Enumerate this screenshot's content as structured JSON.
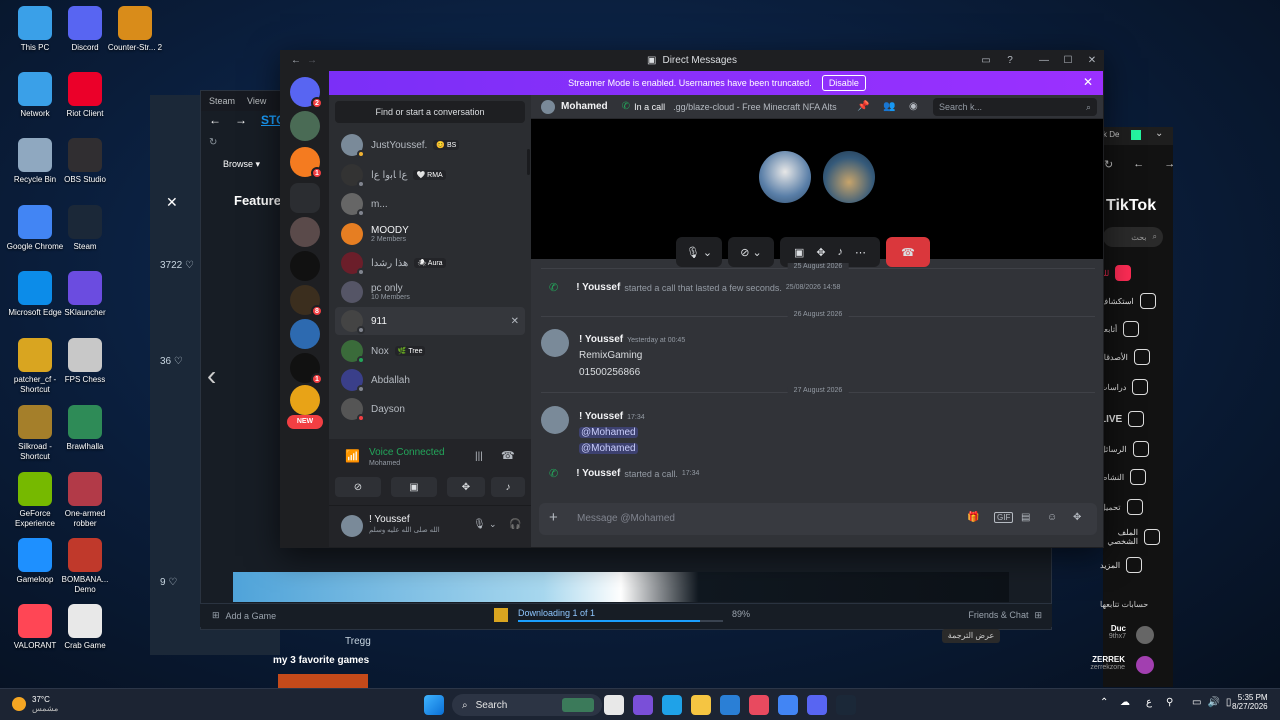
{
  "desktop": {
    "icons": [
      {
        "label": "This PC",
        "icon": "computer-icon",
        "color": "#3aa0e8"
      },
      {
        "label": "Discord",
        "icon": "discord-icon",
        "color": "#5865f2"
      },
      {
        "label": "Counter-Str... 2",
        "icon": "cs2-icon",
        "color": "#d98c1a"
      },
      {
        "label": "Network",
        "icon": "network-icon",
        "color": "#3aa0e8"
      },
      {
        "label": "Riot Client",
        "icon": "riot-icon",
        "color": "#eb0029"
      },
      {
        "label": "Recycle Bin",
        "icon": "recycle-bin-icon",
        "color": "#8fa8c0"
      },
      {
        "label": "OBS Studio",
        "icon": "obs-icon",
        "color": "#302e31"
      },
      {
        "label": "Google Chrome",
        "icon": "chrome-icon",
        "color": "#4285f4"
      },
      {
        "label": "Steam",
        "icon": "steam-icon",
        "color": "#1b2838"
      },
      {
        "label": "Microsoft Edge",
        "icon": "edge-icon",
        "color": "#0c8ce9"
      },
      {
        "label": "SKlauncher",
        "icon": "sklauncher-icon",
        "color": "#6b4ce0"
      },
      {
        "label": "patcher_cf - Shortcut",
        "icon": "patcher-icon",
        "color": "#d9a520"
      },
      {
        "label": "FPS Chess",
        "icon": "chess-icon",
        "color": "#c8c8c8"
      },
      {
        "label": "Silkroad - Shortcut",
        "icon": "silkroad-icon",
        "color": "#a57f2a"
      },
      {
        "label": "Brawlhalla",
        "icon": "brawlhalla-icon",
        "color": "#2e8b57"
      },
      {
        "label": "GeForce Experience",
        "icon": "geforce-icon",
        "color": "#76b900"
      },
      {
        "label": "One-armed robber",
        "icon": "oar-icon",
        "color": "#b23a48"
      },
      {
        "label": "Gameloop",
        "icon": "gameloop-icon",
        "color": "#1e90ff"
      },
      {
        "label": "BOMBANA... Demo",
        "icon": "bombana-icon",
        "color": "#c0392b"
      },
      {
        "label": "VALORANT",
        "icon": "valorant-icon",
        "color": "#ff4655"
      },
      {
        "label": "Crab Game",
        "icon": "crab-game-icon",
        "color": "#e8e8e8"
      }
    ]
  },
  "steam": {
    "menu": [
      "Steam",
      "View"
    ],
    "store_label": "STOR",
    "browse_label": "Browse",
    "featured_label": "Feature",
    "likes": [
      "3722 ♡",
      "36 ♡",
      "9 ♡"
    ],
    "add_game": "Add a Game",
    "downloading": "Downloading 1 of 1",
    "download_pct": 89,
    "download_pct_text": "89%",
    "friends_chat": "Friends & Chat",
    "tregg": "Tregg",
    "favorite_games": "my 3 favorite games"
  },
  "tiktok": {
    "logo": "TikTok",
    "search_placeholder": "بحث",
    "nav": [
      "لك",
      "استكشاف",
      "أتابعه",
      "الأصدقاء",
      "دراسات",
      "LIVE",
      "الرسائل",
      "النشاط",
      "تحميل",
      "الملف الشخصي",
      "المزيد"
    ],
    "following_title": "حسابات تتابعها",
    "accounts": [
      {
        "name": "Duc",
        "handle": "9thx7"
      },
      {
        "name": "ZERREK",
        "handle": "zerrekzone"
      }
    ],
    "translate_btn": "عرض الترجمة"
  },
  "discord": {
    "title": "Direct Messages",
    "streamer_text": "Streamer Mode is enabled. Usernames have been truncated.",
    "disable_label": "Disable",
    "find_placeholder": "Find or start a conversation",
    "servers": [
      {
        "badge": "2",
        "color": "#5865f2",
        "icon": "discord-home-icon"
      },
      {
        "badge": "",
        "color": "#4a6b55",
        "icon": "server-icon"
      },
      {
        "badge": "1",
        "color": "#f47b20",
        "icon": "friend-request-icon"
      },
      {
        "badge": "",
        "color": "#5865f2",
        "icon": "folder-icon"
      },
      {
        "badge": "",
        "color": "#5a4a4a",
        "icon": "server-icon"
      },
      {
        "badge": "",
        "color": "#111",
        "icon": "cup-icon"
      },
      {
        "badge": "8",
        "color": "#3b2e1e",
        "icon": "server-icon"
      },
      {
        "badge": "",
        "color": "#2d6ab0",
        "icon": "server-icon"
      },
      {
        "badge": "1",
        "color": "#111",
        "icon": "blackout-icon"
      },
      {
        "badge": "",
        "color": "#e8a317",
        "icon": "dr-icon"
      }
    ],
    "new_badge": "NEW",
    "dms": [
      {
        "name": "JustYoussef.",
        "sub": "",
        "tag": "😊 BS",
        "status": "#f0b232",
        "color": "#7a8a99"
      },
      {
        "name": "ﻉﺍ ﺎﺑﻭﺍ ﻉﺍ",
        "sub": "",
        "tag": "🤍 RMA",
        "status": "#80848e",
        "color": "#333"
      },
      {
        "name": "m...",
        "sub": "",
        "tag": "",
        "status": "#80848e",
        "color": "#666"
      },
      {
        "name": "MOODY",
        "sub": "2 Members",
        "tag": "",
        "status": "",
        "color": "#e67e22"
      },
      {
        "name": "هذا رشدا",
        "sub": "",
        "tag": "🕷 Aura",
        "status": "#80848e",
        "color": "#6b1e2a"
      },
      {
        "name": "pc only",
        "sub": "10 Members",
        "tag": "",
        "status": "",
        "color": "#556"
      },
      {
        "name": "911",
        "sub": "",
        "tag": "",
        "status": "#80848e",
        "color": "#444"
      },
      {
        "name": "Nox",
        "sub": "",
        "tag": "🌿 Tree",
        "status": "#23a55a",
        "color": "#3a6b3a"
      },
      {
        "name": "Abdallah",
        "sub": "",
        "tag": "",
        "status": "#80848e",
        "color": "#3a3f8a"
      },
      {
        "name": "Dayson",
        "sub": "",
        "tag": "",
        "status": "#f23f43",
        "color": "#555"
      }
    ],
    "voice": {
      "label": "Voice Connected",
      "channel": "Mohamed"
    },
    "user": {
      "name": "! Youssef",
      "status": "الله صلى الله عليه وسلم"
    },
    "chat": {
      "recipient": "Mohamed",
      "in_call": "In a call",
      "topic": ".gg/blaze-cloud - Free Minecraft NFA Alts",
      "search_placeholder": "Search k...",
      "composer_placeholder": "Message @Mohamed"
    },
    "messages": {
      "d1": "25 August 2026",
      "sys1_author": "! Youssef",
      "sys1_text": "started a call that lasted a few seconds.",
      "sys1_time": "25/08/2026 14:58",
      "d2": "26 August 2026",
      "m1_author": "! Youssef",
      "m1_time": "Yesterday at 00:45",
      "m1_line1": "RemixGaming",
      "m1_line2": "01500256866",
      "d3": "27 August 2026",
      "m2_author": "! Youssef",
      "m2_time": "17:34",
      "m2_mention1": "@Mohamed",
      "m2_mention2": "@Mohamed",
      "sys2_author": "! Youssef",
      "sys2_text": "started a call.",
      "sys2_time": "17:34"
    }
  },
  "taskbar": {
    "weather_temp": "37°C",
    "weather_desc": "مشمس",
    "search_label": "Search",
    "lang": "ع",
    "time": "5:35 PM",
    "date": "8/27/2026"
  }
}
